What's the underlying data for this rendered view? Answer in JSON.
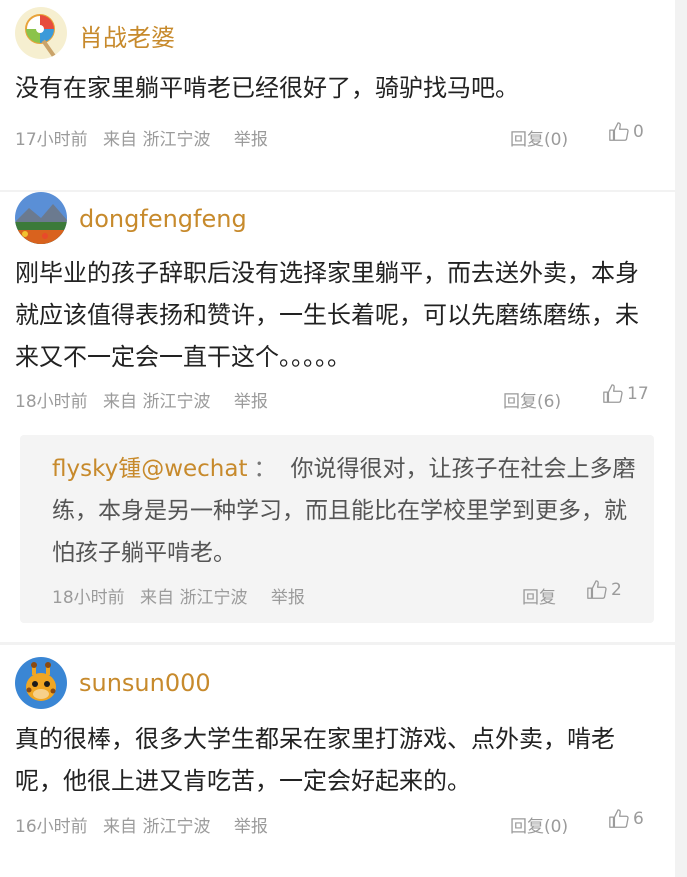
{
  "comments": [
    {
      "username": "肖战老婆",
      "text": "没有在家里躺平啃老已经很好了，骑驴找马吧。",
      "time": "17小时前",
      "from": "来自 浙江宁波",
      "report": "举报",
      "reply": "回复(0)",
      "likes": "0"
    },
    {
      "username": "dongfengfeng",
      "text": "刚毕业的孩子辞职后没有选择家里躺平，而去送外卖，本身就应该值得表扬和赞许，一生长着呢，可以先磨练磨练，未来又不一定会一直干这个。。。。。",
      "time": "18小时前",
      "from": "来自 浙江宁波",
      "report": "举报",
      "reply": "回复(6)",
      "likes": "17",
      "quoted_reply": {
        "username": "flysky锺@wechat",
        "separator": "：",
        "text": "你说得很对，让孩子在社会上多磨练，本身是另一种学习，而且能比在学校里学到更多，就怕孩子躺平啃老。",
        "time": "18小时前",
        "from": "来自 浙江宁波",
        "report": "举报",
        "reply": "回复",
        "likes": "2"
      }
    },
    {
      "username": "sunsun000",
      "text": "真的很棒，很多大学生都呆在家里打游戏、点外卖，啃老呢，他很上进又肯吃苦，一定会好起来的。",
      "time": "16小时前",
      "from": "来自 浙江宁波",
      "report": "举报",
      "reply": "回复(0)",
      "likes": "6"
    }
  ]
}
